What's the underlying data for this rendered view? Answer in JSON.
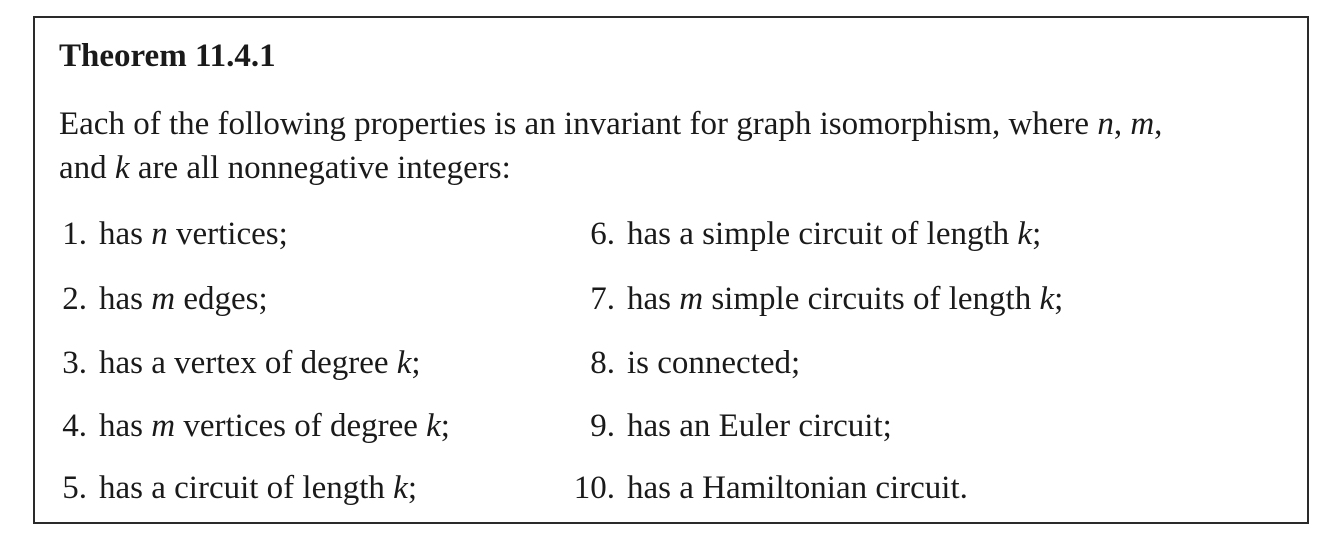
{
  "theorem": {
    "title": "Theorem 11.4.1",
    "intro_line1_prefix": "Each of the following properties is an invariant for graph isomorphism, where ",
    "var_n": "n",
    "var_m": "m",
    "var_k": "k",
    "intro_line2_prefix": "and ",
    "intro_line2_suffix": " are all nonnegative integers:",
    "items": [
      {
        "num": "1.",
        "pre": "has ",
        "var": "n",
        "post": " vertices;"
      },
      {
        "num": "2.",
        "pre": "has ",
        "var": "m",
        "post": " edges;"
      },
      {
        "num": "3.",
        "pre": "has a vertex of degree ",
        "var": "k",
        "post": ";"
      },
      {
        "num": "4.",
        "pre": "has ",
        "var": "m",
        "mid": " vertices of degree ",
        "var2": "k",
        "post": ";"
      },
      {
        "num": "5.",
        "pre": "has a circuit of length ",
        "var": "k",
        "post": ";"
      },
      {
        "num": "6.",
        "pre": "has a simple circuit of length ",
        "var": "k",
        "post": ";"
      },
      {
        "num": "7.",
        "pre": "has ",
        "var": "m",
        "mid": " simple circuits of length ",
        "var2": "k",
        "post": ";"
      },
      {
        "num": "8.",
        "pre": "is connected;"
      },
      {
        "num": "9.",
        "pre": "has an Euler circuit;"
      },
      {
        "num": "10.",
        "pre": "has a Hamiltonian circuit."
      }
    ]
  }
}
